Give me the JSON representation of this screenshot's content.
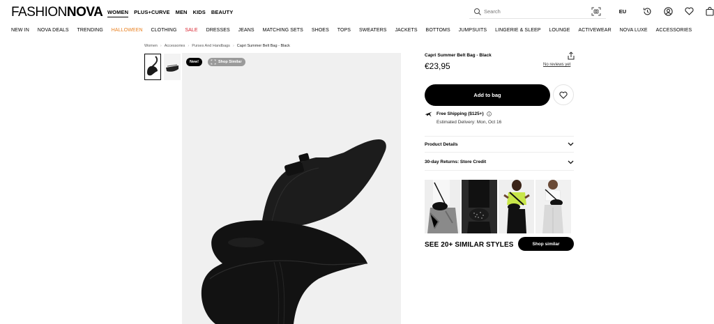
{
  "brand": {
    "light": "FASHION",
    "bold": "NOVA"
  },
  "gender_nav": [
    {
      "label": "WOMEN",
      "active": true
    },
    {
      "label": "PLUS+CURVE"
    },
    {
      "label": "MEN"
    },
    {
      "label": "KIDS"
    },
    {
      "label": "BEAUTY"
    }
  ],
  "search": {
    "placeholder": "Search"
  },
  "header_icons": {
    "region": "EU"
  },
  "categories": [
    "NEW IN",
    "NOVA DEALS",
    "TRENDING",
    "HALLOWEEN",
    "CLOTHING",
    "SALE",
    "DRESSES",
    "JEANS",
    "MATCHING SETS",
    "SHOES",
    "TOPS",
    "SWEATERS",
    "JACKETS",
    "BOTTOMS",
    "JUMPSUITS",
    "LINGERIE & SLEEP",
    "LOUNGE",
    "ACTIVEWEAR",
    "NOVA LUXE",
    "ACCESSORIES"
  ],
  "breadcrumb": [
    "Women",
    "Accessories",
    "Purses And Handbags",
    "Capri Summer Belt Bag - Black"
  ],
  "badges": {
    "new": "New!",
    "shop_similar": "Shop Similar"
  },
  "product": {
    "title": "Capri Summer Belt Bag - Black",
    "price": "€23,95",
    "reviews": "No reviews yet",
    "add_to_bag": "Add to bag",
    "shipping": "Free Shipping ($125+)",
    "delivery": "Estimated Delivery: Mon, Oct 16"
  },
  "accordions": [
    "Product Details",
    "30-day Returns: Store Credit"
  ],
  "similar": {
    "title": "SEE 20+ SIMILAR STYLES",
    "button": "Shop similar"
  },
  "colors": {
    "accent": "#000000",
    "halloween": "#e87e1d",
    "sale": "#d71f2b"
  }
}
